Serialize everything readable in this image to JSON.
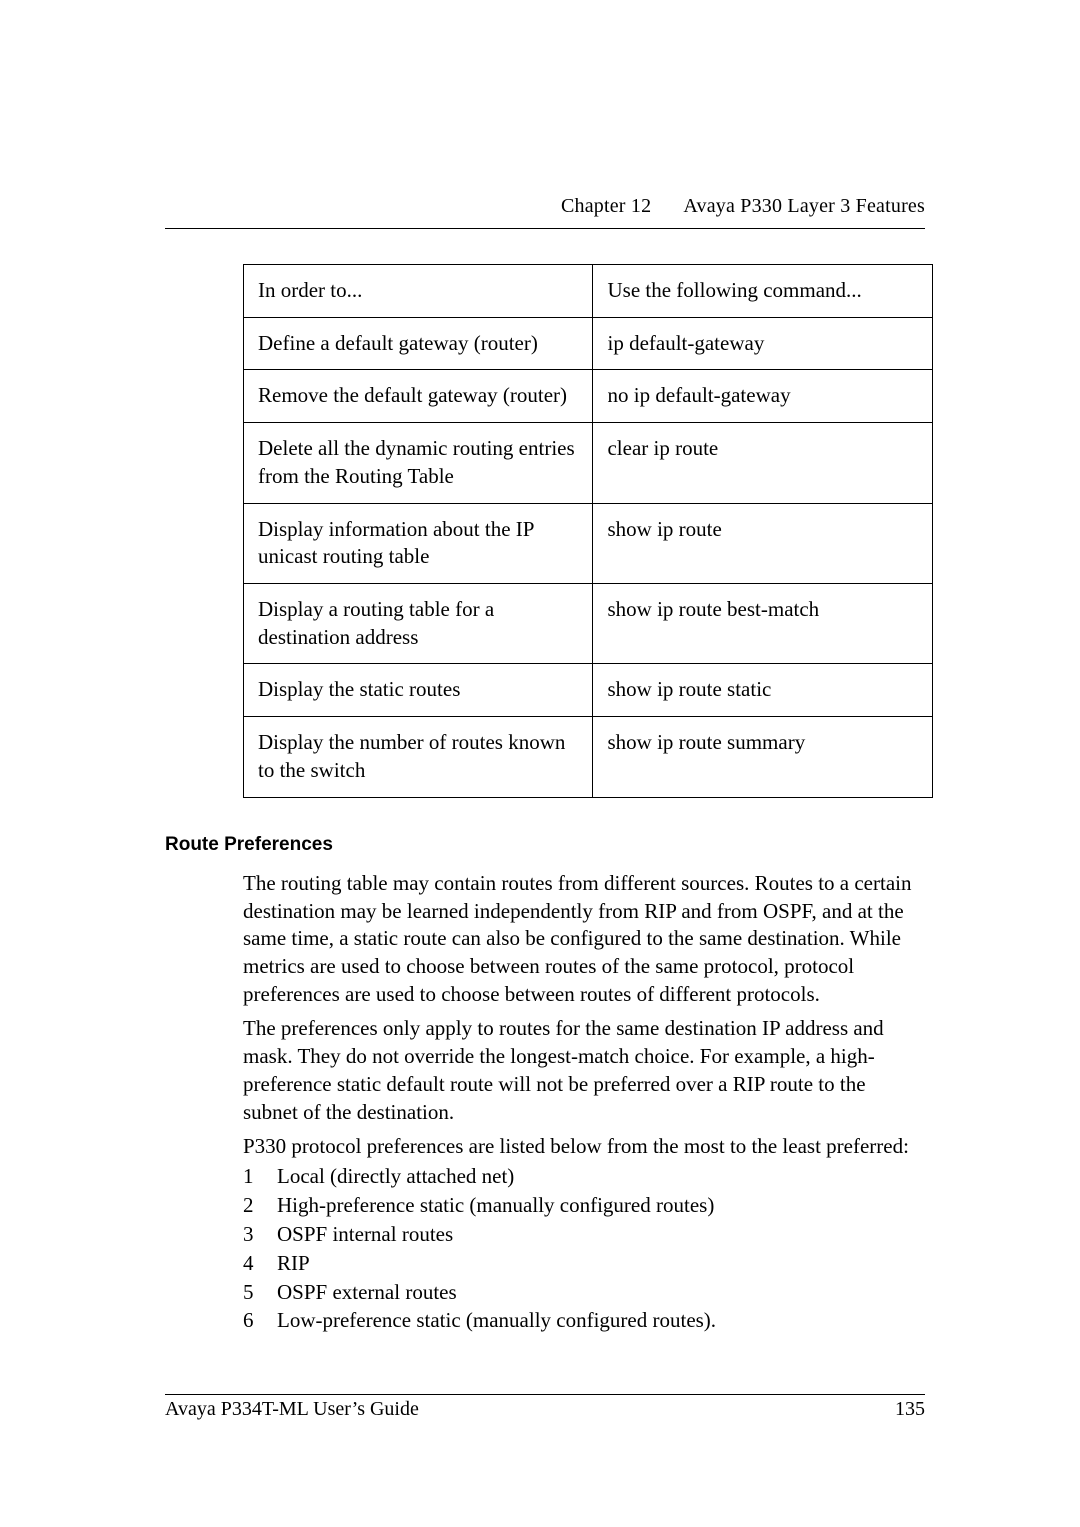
{
  "header": {
    "chapter": "Chapter 12",
    "title": "Avaya P330 Layer 3 Features"
  },
  "table": {
    "header": [
      "In order to...",
      "Use the following command..."
    ],
    "rows": [
      [
        "Define a default gateway (router)",
        "ip default-gateway"
      ],
      [
        "Remove the default gateway (router)",
        "no ip default-gateway"
      ],
      [
        "Delete all the dynamic routing entries from the Routing Table",
        "clear ip route"
      ],
      [
        "Display information about the IP unicast routing table",
        "show ip route"
      ],
      [
        "Display a routing table for a destination address",
        "show ip route best-match"
      ],
      [
        "Display the static routes",
        "show ip route static"
      ],
      [
        "Display the number of routes known to the switch",
        "show ip route summary"
      ]
    ]
  },
  "section": {
    "heading": "Route Preferences",
    "p1": "The routing table may contain routes from different sources. Routes to a certain destination may be learned independently from RIP and from OSPF, and at the same time, a static route can also be configured to the same destination. While metrics are used to choose between routes of the same protocol, protocol preferences are used to choose between routes of different protocols.",
    "p2": "The preferences only apply to routes for the same destination IP address and mask. They do not override the longest-match choice. For example, a high-preference static default route will not be preferred over a RIP route to the subnet of the destination.",
    "p3": "P330 protocol preferences are listed below from the most to the least preferred:",
    "list": [
      "Local (directly attached net)",
      "High-preference static (manually configured routes)",
      "OSPF internal routes",
      "RIP",
      "OSPF external routes",
      "Low-preference static (manually configured routes)."
    ]
  },
  "footer": {
    "doc": "Avaya P334T-ML User’s Guide",
    "page": "135"
  }
}
